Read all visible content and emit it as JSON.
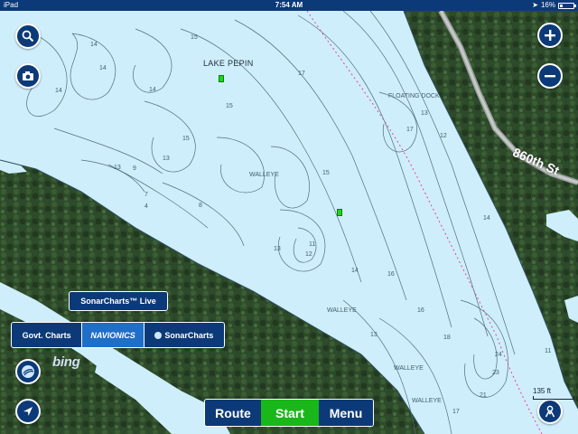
{
  "status_bar": {
    "device": "iPad",
    "time": "7:54 AM",
    "battery": "16%"
  },
  "map": {
    "lake_name": "LAKE PEPIN",
    "road_label": "860th St",
    "poi_labels": [
      "FLOATING DOCK",
      "WALLEYE",
      "WALLEYE",
      "WALLEYE",
      "WALLEYE"
    ],
    "depths": [
      "15",
      "14",
      "14",
      "14",
      "14",
      "15",
      "17",
      "13",
      "15",
      "12",
      "13",
      "13",
      "9",
      "7",
      "4",
      "8",
      "15",
      "11",
      "12",
      "13",
      "14",
      "16",
      "17",
      "14",
      "13",
      "16",
      "18",
      "24",
      "23",
      "21",
      "11",
      "17"
    ],
    "water_color": "#cfeefb",
    "contour_color": "#4f6f7a",
    "track_color": "#e04a8c"
  },
  "chart_selector": {
    "sonar_live": "SonarCharts™ Live",
    "govt": "Govt. Charts",
    "navionics": "NAVIONICS",
    "sonar": "SonarCharts"
  },
  "attribution": "bing",
  "bottom_bar": {
    "route": "Route",
    "start": "Start",
    "menu": "Menu"
  },
  "scale": {
    "label": "135 ft"
  },
  "colors": {
    "bar_blue": "#0c3a78",
    "start_green": "#19b719",
    "accent": "#1f6ec7"
  }
}
